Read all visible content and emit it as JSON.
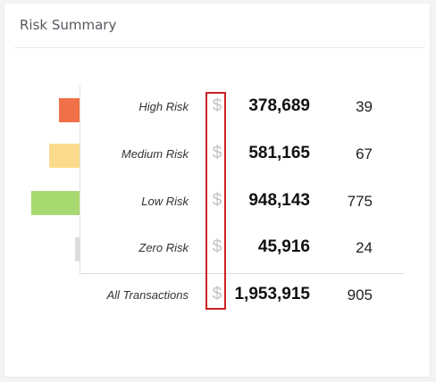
{
  "card": {
    "title": "Risk Summary"
  },
  "rows": [
    {
      "label": "High Risk",
      "currency": "$",
      "amount": "378,689",
      "count": "39",
      "bar_color": "#f07048",
      "share": 0.19
    },
    {
      "label": "Medium Risk",
      "currency": "$",
      "amount": "581,165",
      "count": "67",
      "bar_color": "#fcdc8c",
      "share": 0.3
    },
    {
      "label": "Low Risk",
      "currency": "$",
      "amount": "948,143",
      "count": "775",
      "bar_color": "#a8d870",
      "share": 0.49
    },
    {
      "label": "Zero Risk",
      "currency": "$",
      "amount": "45,916",
      "count": "24",
      "bar_color": "#dcdcdc",
      "share": 0.02
    }
  ],
  "total": {
    "label": "All Transactions",
    "currency": "$",
    "amount": "1,953,915",
    "count": "905"
  },
  "colors": {
    "highlight": "#cc2222",
    "currency_symbol": "#c2c2c2"
  }
}
